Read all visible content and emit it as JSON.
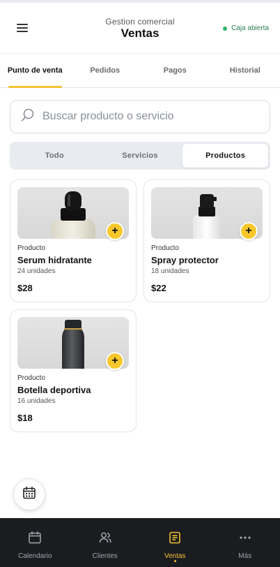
{
  "header": {
    "subtitle": "Gestion comercial",
    "title": "Ventas",
    "status": "Caja abierta",
    "menu_icon": "menu-icon"
  },
  "tabs": [
    {
      "label": "Punto de venta",
      "active": true
    },
    {
      "label": "Pedidos",
      "active": false
    },
    {
      "label": "Pagos",
      "active": false
    },
    {
      "label": "Historial",
      "active": false
    }
  ],
  "search": {
    "placeholder": "Buscar producto o servicio",
    "value": "",
    "icon": "search-icon"
  },
  "filter": {
    "options": [
      "Todo",
      "Servicios",
      "Productos"
    ],
    "selected": "Productos"
  },
  "products": [
    {
      "type": "Producto",
      "name": "Serum hidratante",
      "qty": "24 unidades",
      "price": "$28",
      "image": "serum-dropper-bottle"
    },
    {
      "type": "Producto",
      "name": "Spray protector",
      "qty": "18 unidades",
      "price": "$22",
      "image": "spray-bottle"
    },
    {
      "type": "Producto",
      "name": "Botella deportiva",
      "qty": "16 unidades",
      "price": "$18",
      "image": "sport-bottle"
    }
  ],
  "add_button_symbol": "+",
  "bottom_nav": [
    {
      "label": "Calendario",
      "icon": "calendar-icon",
      "active": false
    },
    {
      "label": "Clientes",
      "icon": "users-icon",
      "active": false
    },
    {
      "label": "Ventas",
      "icon": "receipt-icon",
      "active": true
    },
    {
      "label": "Más",
      "icon": "more-icon",
      "active": false
    }
  ],
  "colors": {
    "accent": "#f2c230",
    "status": "#2fb36b",
    "nav_bg": "#1b1c20"
  }
}
